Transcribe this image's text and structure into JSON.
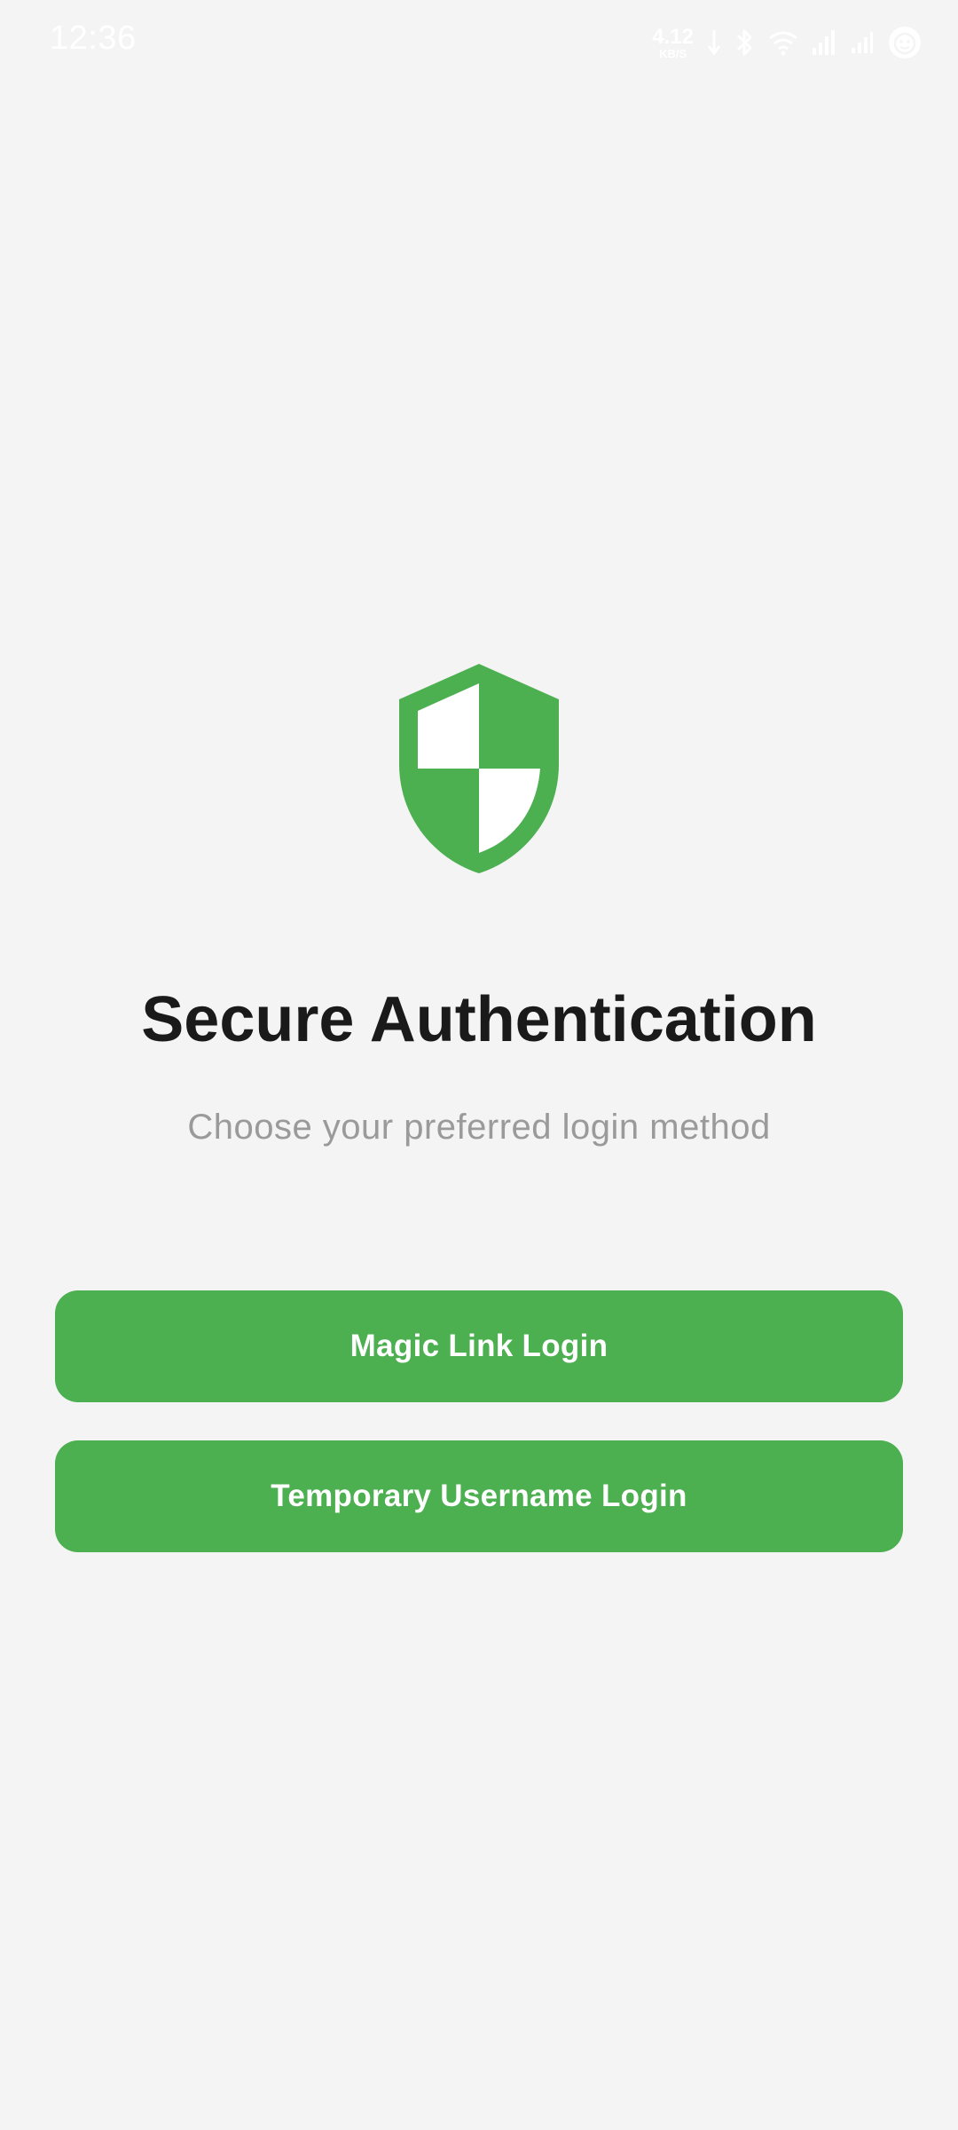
{
  "status_bar": {
    "time": "12:36",
    "net_speed_value": "4.12",
    "net_speed_unit": "KB/S",
    "icons": [
      "data-arrows-icon",
      "bluetooth-icon",
      "wifi-icon",
      "signal-icon",
      "signal-icon-2",
      "face-icon"
    ]
  },
  "auth": {
    "icon": "shield-icon",
    "title": "Secure Authentication",
    "subtitle": "Choose your preferred login method",
    "magic_link_label": "Magic Link Login",
    "temp_username_label": "Temporary Username Login"
  },
  "colors": {
    "accent": "#4caf50",
    "background": "#f4f4f4",
    "title": "#1a1a1a",
    "subtitle": "#9a9a9a"
  }
}
